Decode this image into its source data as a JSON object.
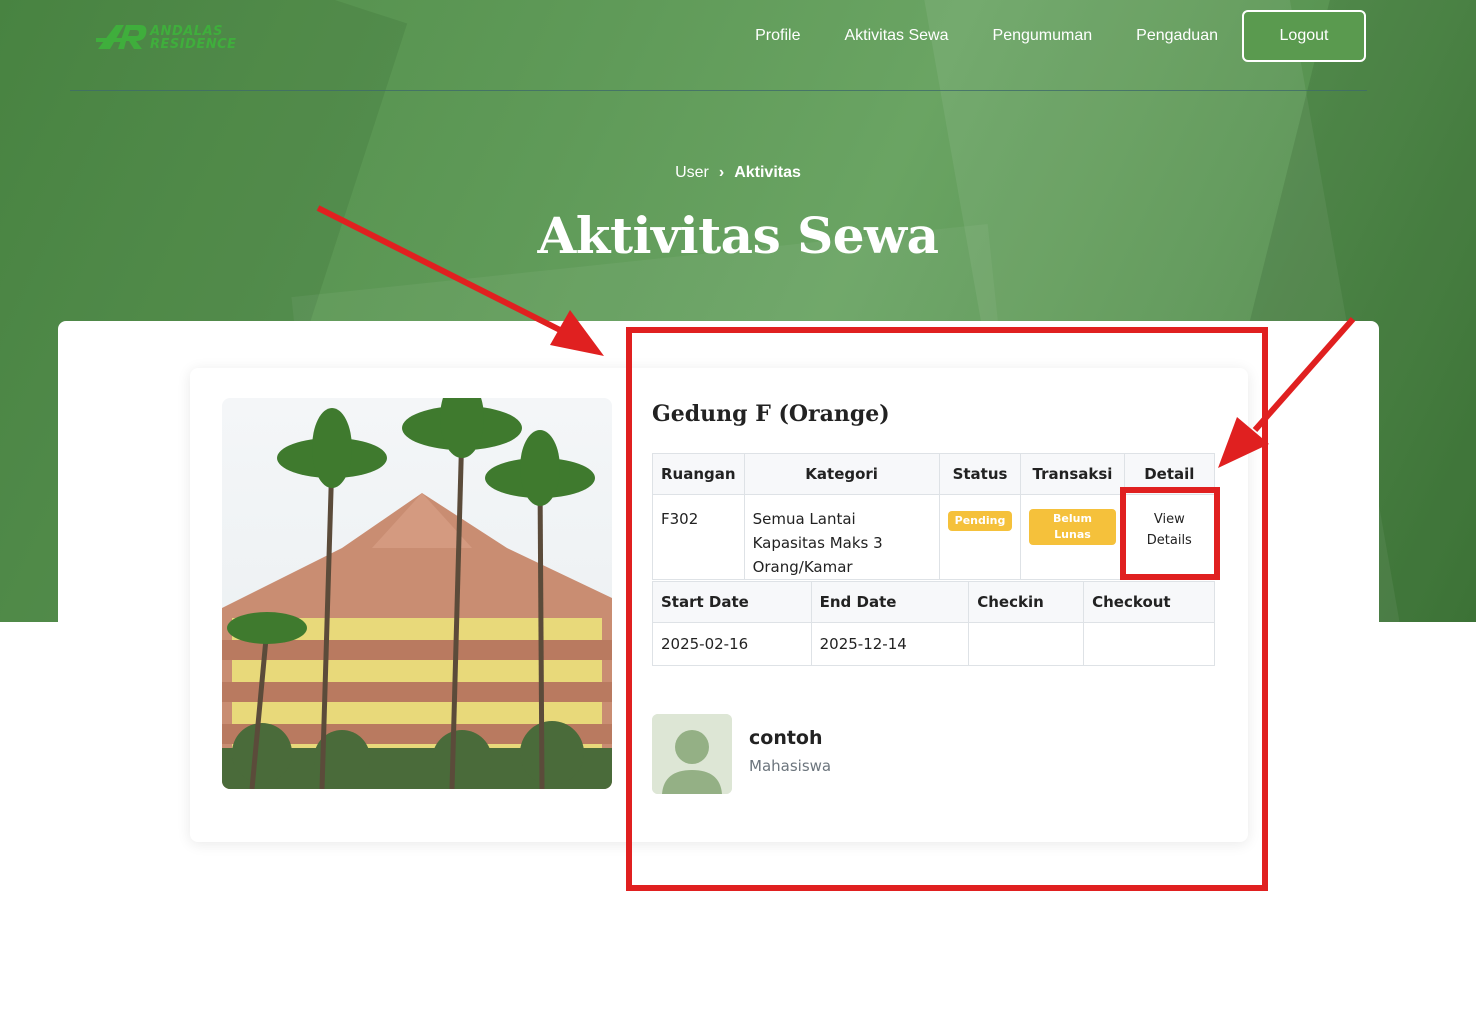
{
  "brand": {
    "line1": "ANDALAS",
    "line2": "RESIDENCE"
  },
  "nav": {
    "items": [
      "Profile",
      "Aktivitas Sewa",
      "Pengumuman",
      "Pengaduan"
    ],
    "logout": "Logout"
  },
  "breadcrumb": {
    "parent": "User",
    "separator": "›",
    "current": "Aktivitas"
  },
  "page_title": "Aktivitas Sewa",
  "rental": {
    "building": "Gedung F (Orange)",
    "table1": {
      "headers": [
        "Ruangan",
        "Kategori",
        "Status",
        "Transaksi",
        "Detail"
      ],
      "row": {
        "ruangan": "F302",
        "kategori": "Semua Lantai Kapasitas Maks 3 Orang/Kamar",
        "status": "Pending",
        "transaksi": "Belum Lunas",
        "detail_line1": "View",
        "detail_line2": "Details"
      }
    },
    "table2": {
      "headers": [
        "Start Date",
        "End Date",
        "Checkin",
        "Checkout"
      ],
      "row": {
        "start": "2025-02-16",
        "end": "2025-12-14",
        "checkin": "",
        "checkout": ""
      }
    }
  },
  "user": {
    "name": "contoh",
    "role": "Mahasiswa"
  },
  "colors": {
    "hero_green": "#5f9a58",
    "badge_yellow": "#f5c13b",
    "annotation_red": "#e02020",
    "logo_green": "#3fae3c"
  }
}
